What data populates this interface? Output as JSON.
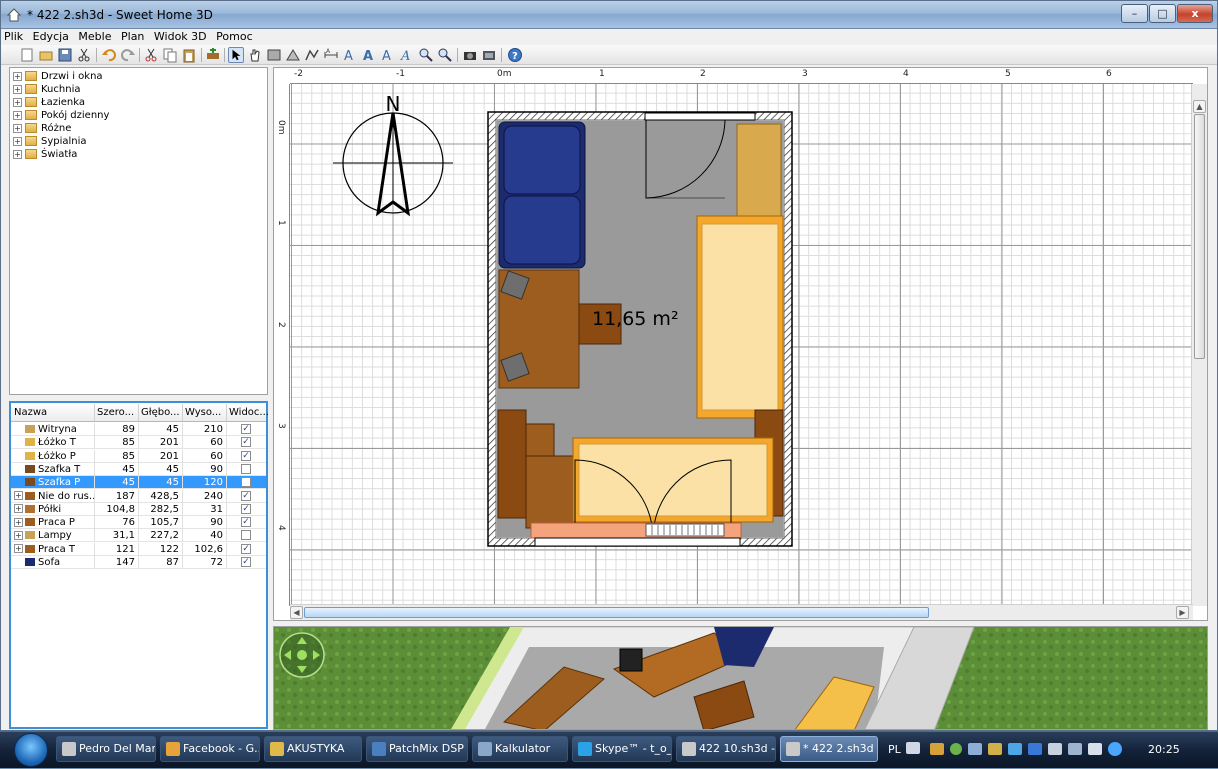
{
  "window": {
    "title": "* 422 2.sh3d - Sweet Home 3D",
    "minimize": "–",
    "maximize": "□",
    "close": "x"
  },
  "menu": [
    "Plik",
    "Edycja",
    "Meble",
    "Plan",
    "Widok 3D",
    "Pomoc"
  ],
  "toolbar_icons": [
    "new-icon",
    "open-icon",
    "save-icon",
    "cut-icon",
    "undo-icon",
    "redo-icon",
    "cut2-icon",
    "copy-icon",
    "paste-icon",
    "add-furniture-icon",
    "select-icon",
    "pan-icon",
    "create-walls-icon",
    "create-rooms-icon",
    "create-dimensions-icon",
    "add-text-icon",
    "text-style-icon",
    "text-style-icon",
    "text-style-icon",
    "text-style-icon",
    "zoom-in-icon",
    "zoom-out-icon",
    "photo-icon",
    "video-icon",
    "help-icon"
  ],
  "catalog": {
    "categories": [
      "Drzwi i okna",
      "Kuchnia",
      "Łazienka",
      "Pokój dzienny",
      "Różne",
      "Sypialnia",
      "Światła"
    ]
  },
  "furniture_table": {
    "columns": [
      "Nazwa",
      "Szero...",
      "Głębo...",
      "Wyso...",
      "Widoc..."
    ],
    "rows": [
      {
        "name": "Witryna",
        "w": "89",
        "d": "45",
        "h": "210",
        "visible": true,
        "group": false,
        "selected": false
      },
      {
        "name": "Łóżko T",
        "w": "85",
        "d": "201",
        "h": "60",
        "visible": true,
        "group": false,
        "selected": false
      },
      {
        "name": "Łóżko P",
        "w": "85",
        "d": "201",
        "h": "60",
        "visible": true,
        "group": false,
        "selected": false
      },
      {
        "name": "Szafka T",
        "w": "45",
        "d": "45",
        "h": "90",
        "visible": false,
        "group": false,
        "selected": false
      },
      {
        "name": "Szafka P",
        "w": "45",
        "d": "45",
        "h": "120",
        "visible": false,
        "group": false,
        "selected": true
      },
      {
        "name": "Nie do rus...",
        "w": "187",
        "d": "428,5",
        "h": "240",
        "visible": true,
        "group": true,
        "selected": false
      },
      {
        "name": "Półki",
        "w": "104,8",
        "d": "282,5",
        "h": "31",
        "visible": true,
        "group": true,
        "selected": false
      },
      {
        "name": "Praca P",
        "w": "76",
        "d": "105,7",
        "h": "90",
        "visible": true,
        "group": true,
        "selected": false
      },
      {
        "name": "Lampy",
        "w": "31,1",
        "d": "227,2",
        "h": "40",
        "visible": false,
        "group": true,
        "selected": false
      },
      {
        "name": "Praca T",
        "w": "121",
        "d": "122",
        "h": "102,6",
        "visible": true,
        "group": true,
        "selected": false
      },
      {
        "name": "Sofa",
        "w": "147",
        "d": "87",
        "h": "72",
        "visible": true,
        "group": false,
        "selected": false
      }
    ]
  },
  "plan": {
    "ruler_h": [
      "-2",
      "-1",
      "0m",
      "1",
      "2",
      "3",
      "4",
      "5",
      "6"
    ],
    "ruler_v": [
      "0m",
      "1",
      "2",
      "3",
      "4"
    ],
    "compass_label": "N",
    "room_area": "11,65 m²"
  },
  "taskbar": {
    "items": [
      {
        "label": "Pedro Del Mar...",
        "icon_color": "#c9c9c9"
      },
      {
        "label": "Facebook - G...",
        "icon_color": "#e8a23a"
      },
      {
        "label": "AKUSTYKA",
        "icon_color": "#e0b94a"
      },
      {
        "label": "PatchMix DSP",
        "icon_color": "#4a7fc0"
      },
      {
        "label": "Kalkulator",
        "icon_color": "#8aa6c8"
      },
      {
        "label": "Skype™ - t_o_...",
        "icon_color": "#2aa3e6"
      },
      {
        "label": "422 10.sh3d - ...",
        "icon_color": "#c9c9c9"
      },
      {
        "label": "* 422 2.sh3d - ...",
        "icon_color": "#c9c9c9"
      }
    ],
    "language": "PL",
    "clock": "20:25"
  }
}
